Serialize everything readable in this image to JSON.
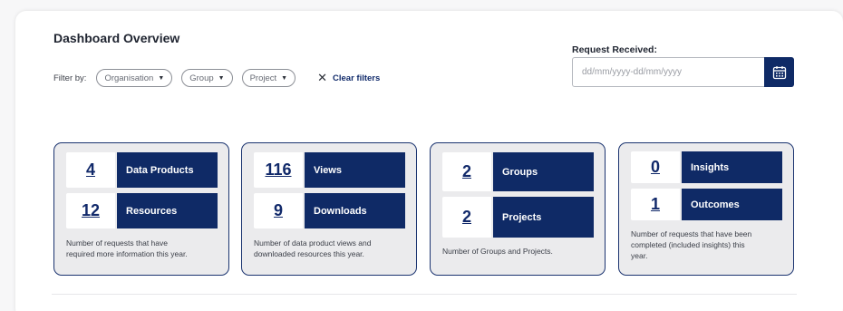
{
  "header": {
    "title": "Dashboard Overview"
  },
  "filters": {
    "label": "Filter by:",
    "pills": [
      {
        "label": "Organisation"
      },
      {
        "label": "Group"
      },
      {
        "label": "Project"
      }
    ],
    "clear_label": "Clear filters"
  },
  "request": {
    "label": "Request Received:",
    "placeholder": "dd/mm/yyyy-dd/mm/yyyy",
    "icon": "calendar-icon"
  },
  "cards": [
    {
      "metrics": [
        {
          "value": "4",
          "label": "Data Products"
        },
        {
          "value": "12",
          "label": "Resources"
        }
      ],
      "description": [
        "Number of requests that have",
        "required more information this year."
      ]
    },
    {
      "metrics": [
        {
          "value": "116",
          "label": "Views"
        },
        {
          "value": "9",
          "label": "Downloads"
        }
      ],
      "description": [
        "Number of data product views and",
        "downloaded resources this year."
      ]
    },
    {
      "metrics": [
        {
          "value": "2",
          "label": "Groups"
        },
        {
          "value": "2",
          "label": "Projects"
        }
      ],
      "description": [
        "Number of Groups and Projects."
      ]
    },
    {
      "metrics": [
        {
          "value": "0",
          "label": "Insights"
        },
        {
          "value": "1",
          "label": "Outcomes"
        }
      ],
      "description": [
        "Number of requests that have been",
        "completed (included insights) this",
        "year."
      ]
    }
  ],
  "colors": {
    "navy": "#0f2a66",
    "card_bg": "#ebebed",
    "border": "#1b3470"
  }
}
